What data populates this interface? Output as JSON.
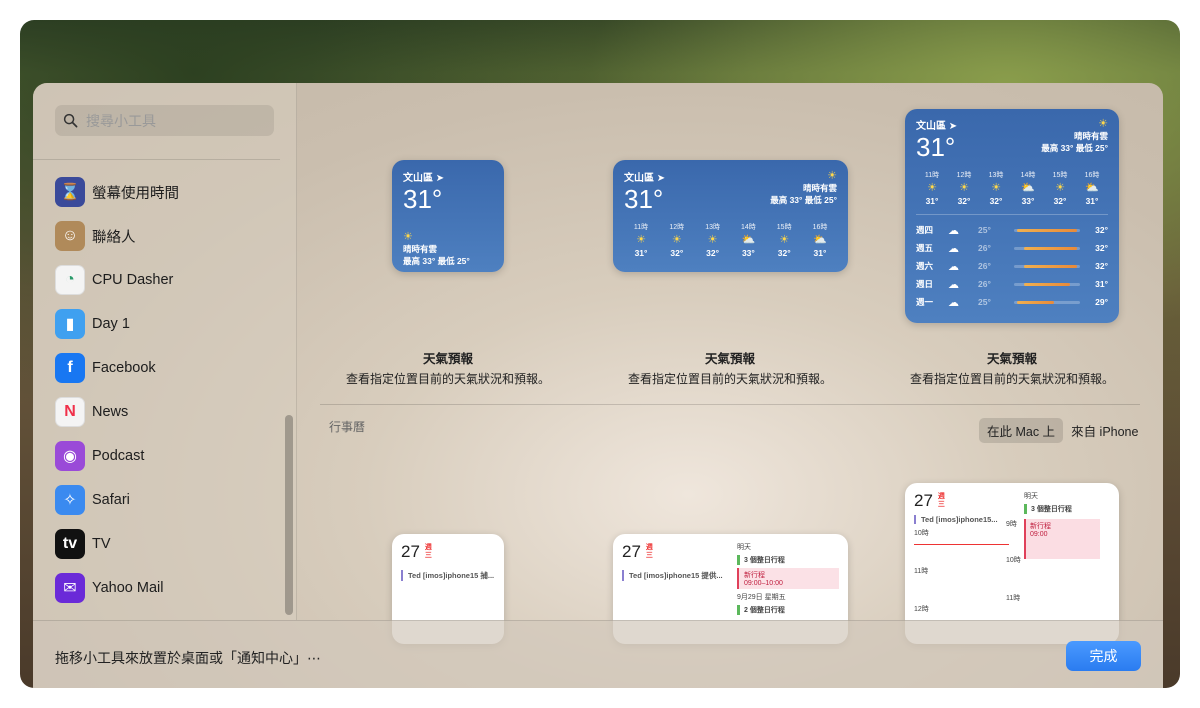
{
  "search": {
    "placeholder": "搜尋小工具"
  },
  "apps": [
    {
      "label": "螢幕使用時間",
      "icon": "hourglass-icon",
      "color": "#3a4a9a",
      "glyph": "⌛"
    },
    {
      "label": "聯絡人",
      "icon": "contacts-icon",
      "color": "#b08a5a",
      "glyph": "☺"
    },
    {
      "label": "CPU Dasher",
      "icon": "gauge-icon",
      "color": "#f4f4f4",
      "glyph": "◔"
    },
    {
      "label": "Day 1",
      "icon": "bookmark-icon",
      "color": "#3fa0f0",
      "glyph": "▮"
    },
    {
      "label": "Facebook",
      "icon": "facebook-icon",
      "color": "#1877f2",
      "glyph": "f"
    },
    {
      "label": "News",
      "icon": "news-icon",
      "color": "#f4f4f4",
      "glyph": "N"
    },
    {
      "label": "Podcast",
      "icon": "podcast-icon",
      "color": "#9a4ad8",
      "glyph": "◉"
    },
    {
      "label": "Safari",
      "icon": "compass-icon",
      "color": "#3a8af0",
      "glyph": "✧"
    },
    {
      "label": "TV",
      "icon": "tv-icon",
      "color": "#111111",
      "glyph": "tv"
    },
    {
      "label": "Yahoo Mail",
      "icon": "mail-icon",
      "color": "#6a2ad8",
      "glyph": "✉"
    }
  ],
  "weather": {
    "city": "文山區",
    "temp": "31°",
    "condition": "晴時有雲",
    "hilo": "最高 33° 最低 25°",
    "hours": [
      {
        "time": "11時",
        "temp": "31°",
        "icon": "sun"
      },
      {
        "time": "12時",
        "temp": "32°",
        "icon": "sun"
      },
      {
        "time": "13時",
        "temp": "32°",
        "icon": "sun"
      },
      {
        "time": "14時",
        "temp": "33°",
        "icon": "partly-cloudy"
      },
      {
        "time": "15時",
        "temp": "32°",
        "icon": "sun"
      },
      {
        "time": "16時",
        "temp": "31°",
        "icon": "partly-cloudy"
      }
    ],
    "days": [
      {
        "name": "週四",
        "lo": "25°",
        "hi": "32°",
        "bar_start": 0.05,
        "bar_end": 0.95
      },
      {
        "name": "週五",
        "lo": "26°",
        "hi": "32°",
        "bar_start": 0.15,
        "bar_end": 0.95
      },
      {
        "name": "週六",
        "lo": "26°",
        "hi": "32°",
        "bar_start": 0.15,
        "bar_end": 0.95
      },
      {
        "name": "週日",
        "lo": "26°",
        "hi": "31°",
        "bar_start": 0.15,
        "bar_end": 0.85
      },
      {
        "name": "週一",
        "lo": "25°",
        "hi": "29°",
        "bar_start": 0.05,
        "bar_end": 0.6
      }
    ],
    "caption_title": "天氣預報",
    "caption_desc": "查看指定位置目前的天氣狀況和預報。"
  },
  "calendar": {
    "section_title": "行事曆",
    "seg_mac": "在此 Mac 上",
    "seg_iphone": "來自 iPhone",
    "day": "27",
    "weekday_top": "週",
    "weekday_bottom": "三",
    "event_small": "Ted [imos]iphone15 捕...",
    "event_medium": "Ted [imos]iphone15 提供...",
    "event_large": "Ted [imos]iphone15...",
    "tomorrow": "明天",
    "allday_3": "3 個整日行程",
    "new_event": "新行程",
    "new_event_time": "09:00–10:00",
    "new_event_time_short": "09:00",
    "date_line": "9月29日 星期五",
    "allday_2": "2 個整日行程",
    "h10": "10時",
    "h11": "11時",
    "h12": "12時",
    "h9": "9時"
  },
  "footer": {
    "hint": "拖移小工具來放置於桌面或「通知中心」⋯",
    "done": "完成"
  }
}
